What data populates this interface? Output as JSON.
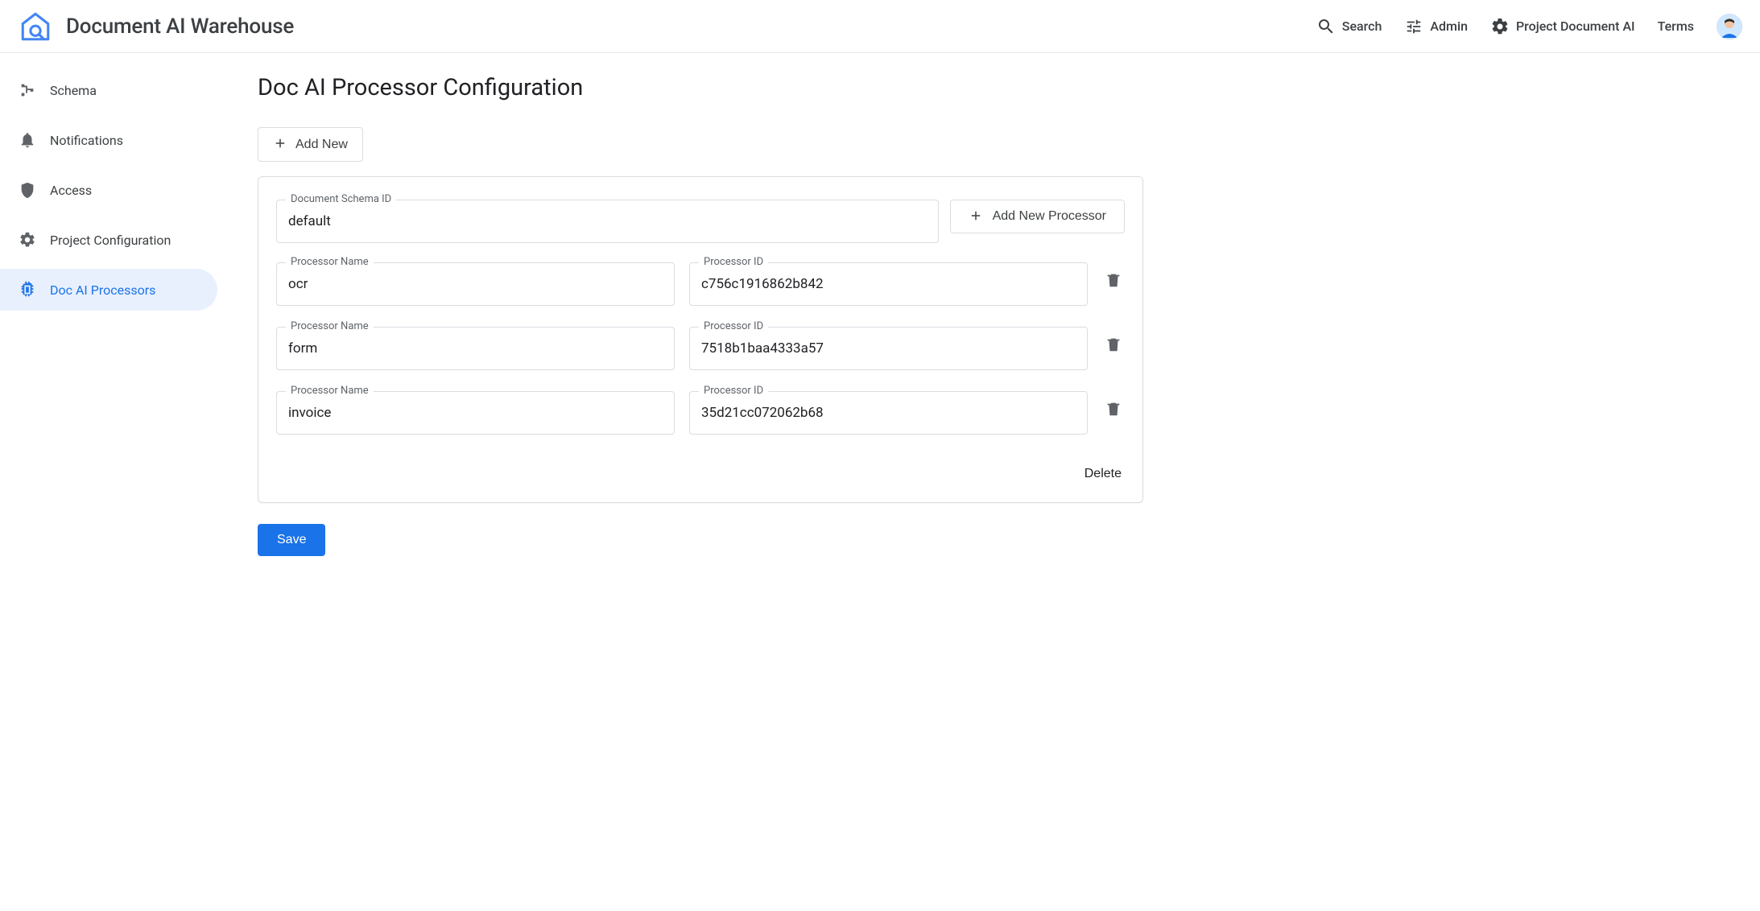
{
  "header": {
    "app_title": "Document AI Warehouse",
    "search_label": "Search",
    "admin_label": "Admin",
    "project_label": "Project Document AI",
    "terms_label": "Terms"
  },
  "sidebar": {
    "items": [
      {
        "label": "Schema"
      },
      {
        "label": "Notifications"
      },
      {
        "label": "Access"
      },
      {
        "label": "Project Configuration"
      },
      {
        "label": "Doc AI Processors"
      }
    ],
    "active_index": 4
  },
  "main": {
    "page_title": "Doc AI Processor Configuration",
    "add_new_label": "Add New",
    "add_new_processor_label": "Add New Processor",
    "delete_label": "Delete",
    "save_label": "Save",
    "field_labels": {
      "schema_id": "Document Schema ID",
      "processor_name": "Processor Name",
      "processor_id": "Processor ID"
    },
    "schema_id_value": "default",
    "processors": [
      {
        "name": "ocr",
        "id": "c756c1916862b842"
      },
      {
        "name": "form",
        "id": "7518b1baa4333a57"
      },
      {
        "name": "invoice",
        "id": "35d21cc072062b68"
      }
    ]
  },
  "colors": {
    "primary": "#1a73e8",
    "primary_bg": "#e8f0fe",
    "border": "#dadce0",
    "text": "#202124",
    "text_secondary": "#5f6368"
  }
}
